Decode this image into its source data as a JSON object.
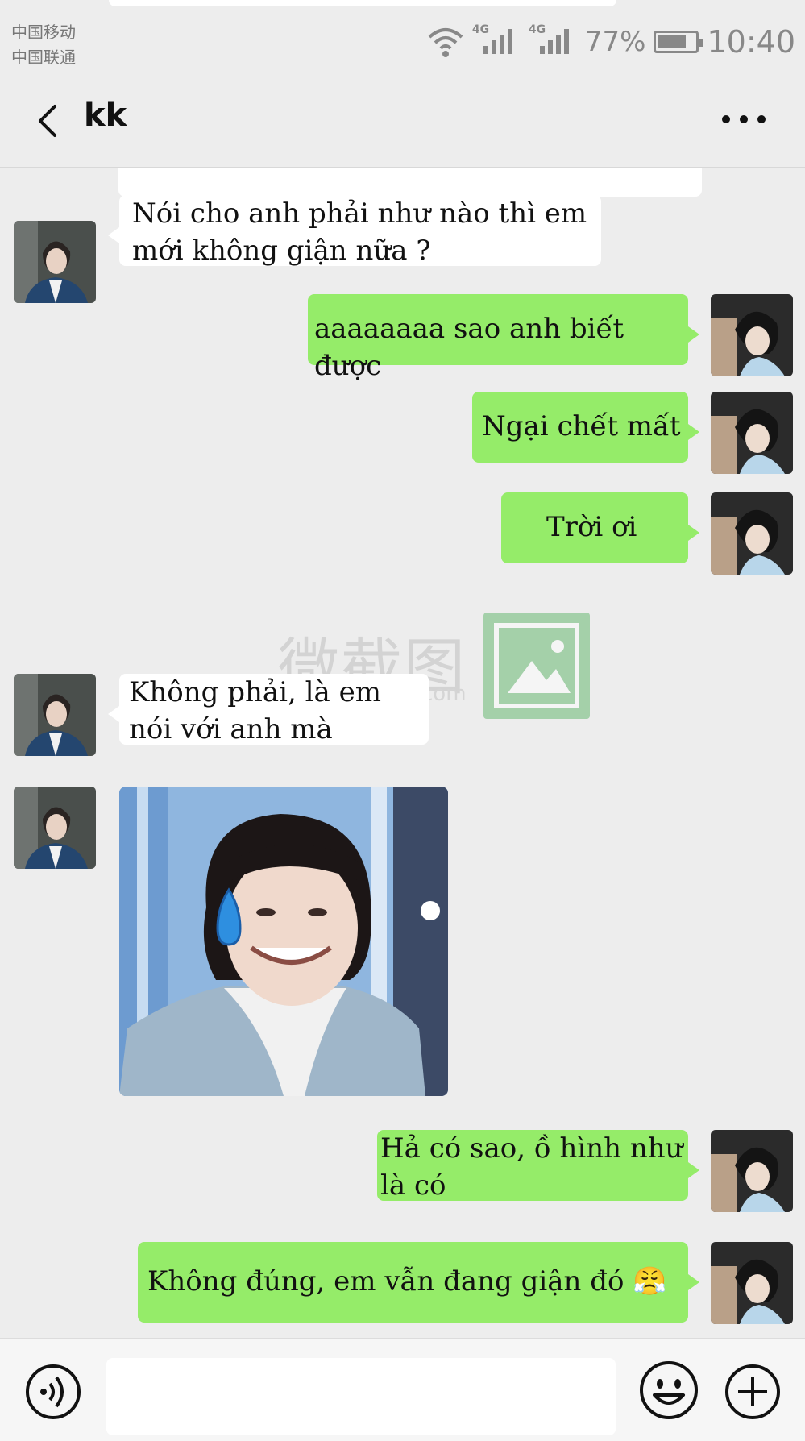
{
  "status_bar": {
    "carrier_1": "中国移动",
    "carrier_2": "中国联通",
    "network_1": "4G",
    "network_2": "4G",
    "battery": "77%",
    "battery_level": 0.77,
    "time": "10:40",
    "icons": [
      "wifi-icon",
      "signal-icon",
      "signal-icon",
      "battery-icon"
    ]
  },
  "header": {
    "title": "kk",
    "back_icon": "chevron-left-icon",
    "more_icon": "more-dots-icon"
  },
  "messages": [
    {
      "side": "left",
      "text_lines": [
        "Nói cho anh phải như nào thì em",
        "mới không giận nữa ?"
      ]
    },
    {
      "side": "right",
      "text_lines": [
        "aaaaaaaa sao anh biết được"
      ]
    },
    {
      "side": "right",
      "text_lines": [
        "Ngại chết mất"
      ]
    },
    {
      "side": "right",
      "text_lines": [
        "Trời ơi"
      ]
    },
    {
      "side": "left",
      "text_lines": [
        "Không phải, là em",
        "nói với anh mà"
      ]
    },
    {
      "side": "left",
      "type": "image"
    },
    {
      "side": "right",
      "text_lines": [
        "Hả có sao, ồ hình như",
        "là có"
      ]
    },
    {
      "side": "right",
      "text_lines": [
        "Không đúng, em vẫn đang giận đó"
      ],
      "emoji": "😤"
    }
  ],
  "watermark": {
    "text": "微截图",
    "suffix": "com"
  },
  "input_bar": {
    "voice_icon": "voice-icon",
    "emoji_icon": "emoji-icon",
    "plus_icon": "plus-icon"
  },
  "colors": {
    "background": "#ededed",
    "sent_bubble": "#95ec69",
    "received_bubble": "#ffffff"
  }
}
